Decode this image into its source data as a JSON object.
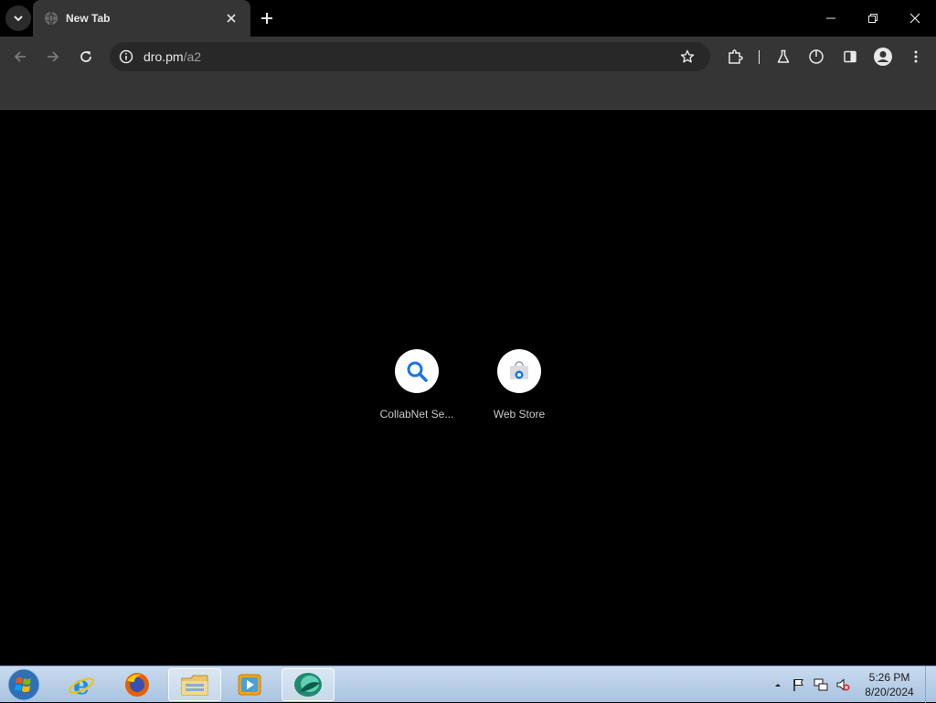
{
  "browser": {
    "tab": {
      "title": "New Tab"
    },
    "address": {
      "host": "dro.pm",
      "path": "/a2"
    }
  },
  "shortcuts": [
    {
      "label": "CollabNet Se..."
    },
    {
      "label": "Web Store"
    }
  ],
  "taskbar": {
    "clock": {
      "time": "5:26 PM",
      "date": "8/20/2024"
    }
  },
  "colors": {
    "background": "#000000",
    "toolbar": "#353535",
    "accent_blue": "#1a73e8"
  }
}
